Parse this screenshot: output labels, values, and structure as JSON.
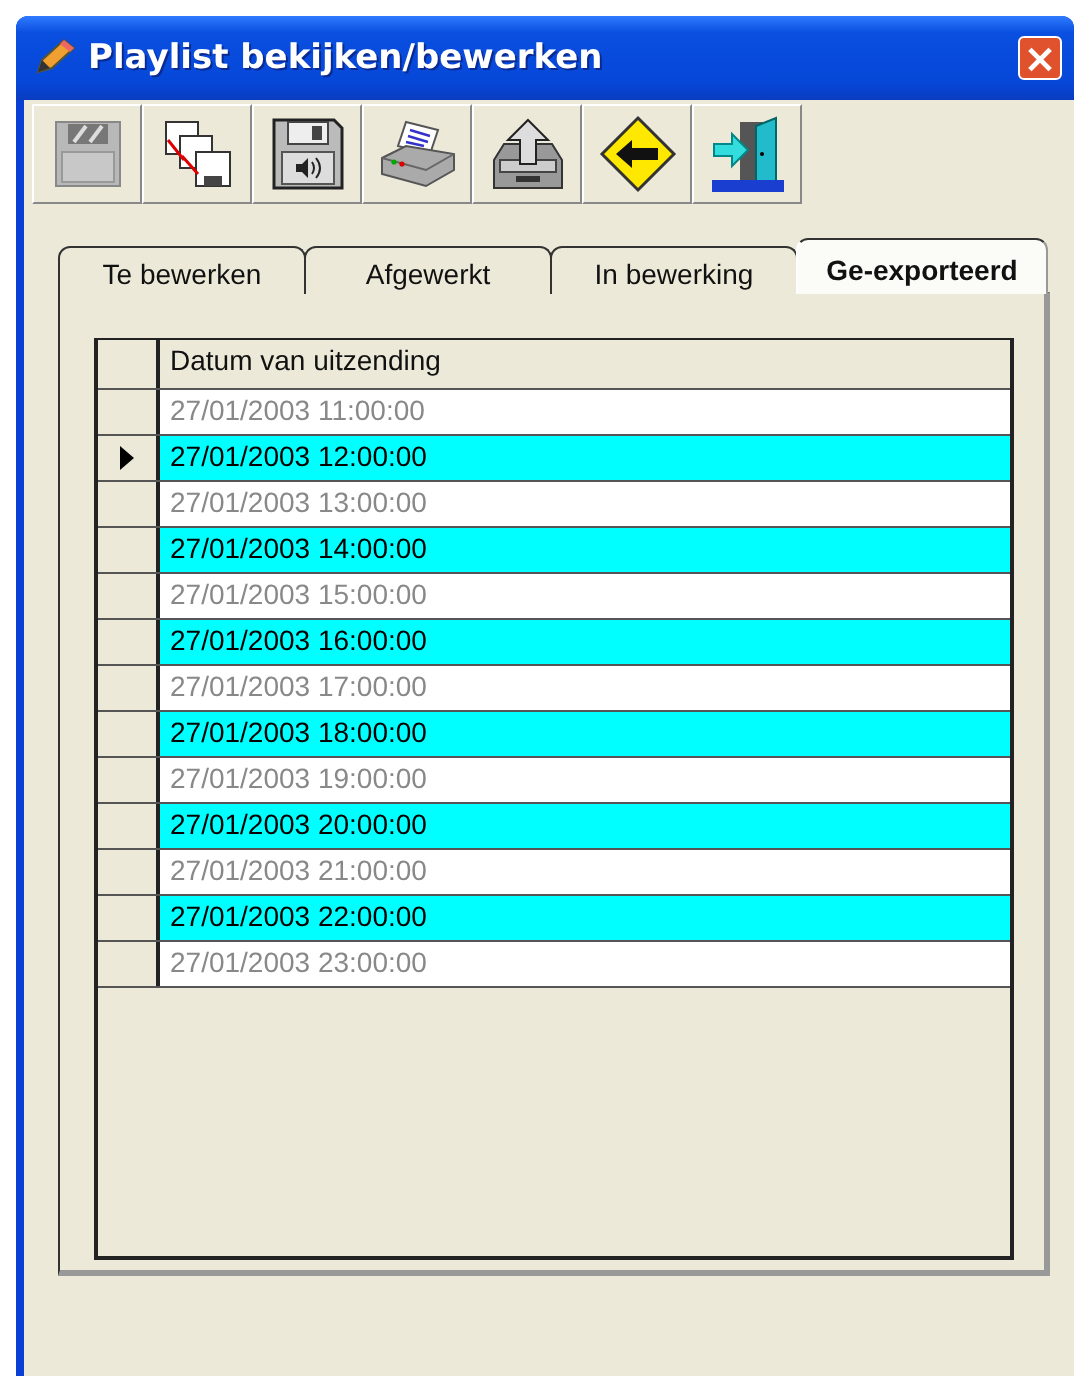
{
  "window": {
    "title": "Playlist bekijken/bewerken",
    "close": "×"
  },
  "toolbar": [
    {
      "kind": "floppy-disabled"
    },
    {
      "kind": "copies"
    },
    {
      "kind": "floppy-sound"
    },
    {
      "kind": "printer"
    },
    {
      "kind": "tray-up"
    },
    {
      "kind": "back-sign"
    },
    {
      "kind": "exit-door"
    }
  ],
  "tabs": [
    {
      "label": "Te bewerken",
      "selected": false
    },
    {
      "label": "Afgewerkt",
      "selected": false
    },
    {
      "label": "In bewerking",
      "selected": false
    },
    {
      "label": "Ge-exporteerd",
      "selected": true
    }
  ],
  "table": {
    "columns": [
      "Datum van uitzending"
    ],
    "rows": [
      {
        "cells": [
          "27/01/2003 11:00:00"
        ],
        "highlighted": false,
        "current": false
      },
      {
        "cells": [
          "27/01/2003 12:00:00"
        ],
        "highlighted": true,
        "current": true
      },
      {
        "cells": [
          "27/01/2003 13:00:00"
        ],
        "highlighted": false,
        "current": false
      },
      {
        "cells": [
          "27/01/2003 14:00:00"
        ],
        "highlighted": true,
        "current": false
      },
      {
        "cells": [
          "27/01/2003 15:00:00"
        ],
        "highlighted": false,
        "current": false
      },
      {
        "cells": [
          "27/01/2003 16:00:00"
        ],
        "highlighted": true,
        "current": false
      },
      {
        "cells": [
          "27/01/2003 17:00:00"
        ],
        "highlighted": false,
        "current": false
      },
      {
        "cells": [
          "27/01/2003 18:00:00"
        ],
        "highlighted": true,
        "current": false
      },
      {
        "cells": [
          "27/01/2003 19:00:00"
        ],
        "highlighted": false,
        "current": false
      },
      {
        "cells": [
          "27/01/2003 20:00:00"
        ],
        "highlighted": true,
        "current": false
      },
      {
        "cells": [
          "27/01/2003 21:00:00"
        ],
        "highlighted": false,
        "current": false
      },
      {
        "cells": [
          "27/01/2003 22:00:00"
        ],
        "highlighted": true,
        "current": false
      },
      {
        "cells": [
          "27/01/2003 23:00:00"
        ],
        "highlighted": false,
        "current": false
      }
    ]
  }
}
